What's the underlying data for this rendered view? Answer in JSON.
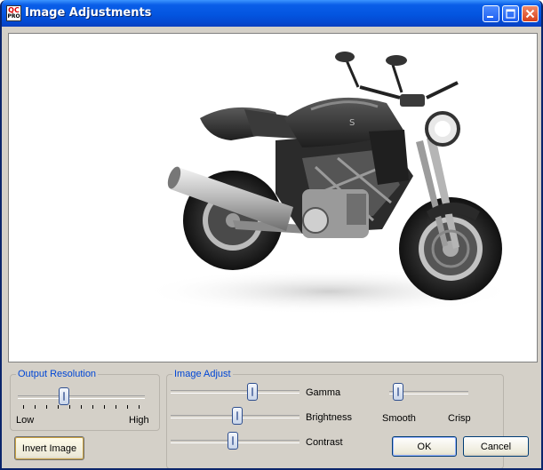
{
  "window": {
    "title": "Image Adjustments",
    "app_icon_top": "QC",
    "app_icon_bottom": "PRO"
  },
  "titlebar_buttons": [
    "minimize-icon",
    "maximize-icon",
    "close-icon"
  ],
  "image_preview": {
    "subject": "motorcycle"
  },
  "output_resolution": {
    "legend": "Output Resolution",
    "low_label": "Low",
    "high_label": "High",
    "tick_count": 11,
    "value_fraction": 0.35
  },
  "image_adjust": {
    "legend": "Image Adjust",
    "gamma_label": "Gamma",
    "gamma_fraction": 0.65,
    "brightness_label": "Brightness",
    "brightness_fraction": 0.52,
    "contrast_label": "Contrast",
    "contrast_fraction": 0.48,
    "sharpness_fraction": 0.05,
    "smooth_label": "Smooth",
    "crisp_label": "Crisp"
  },
  "buttons": {
    "invert_label": "Invert Image",
    "ok_label": "OK",
    "cancel_label": "Cancel"
  },
  "colors": {
    "titlebar": "#0355e0",
    "legend_text": "#0046d5",
    "panel": "#d4d0c8"
  }
}
